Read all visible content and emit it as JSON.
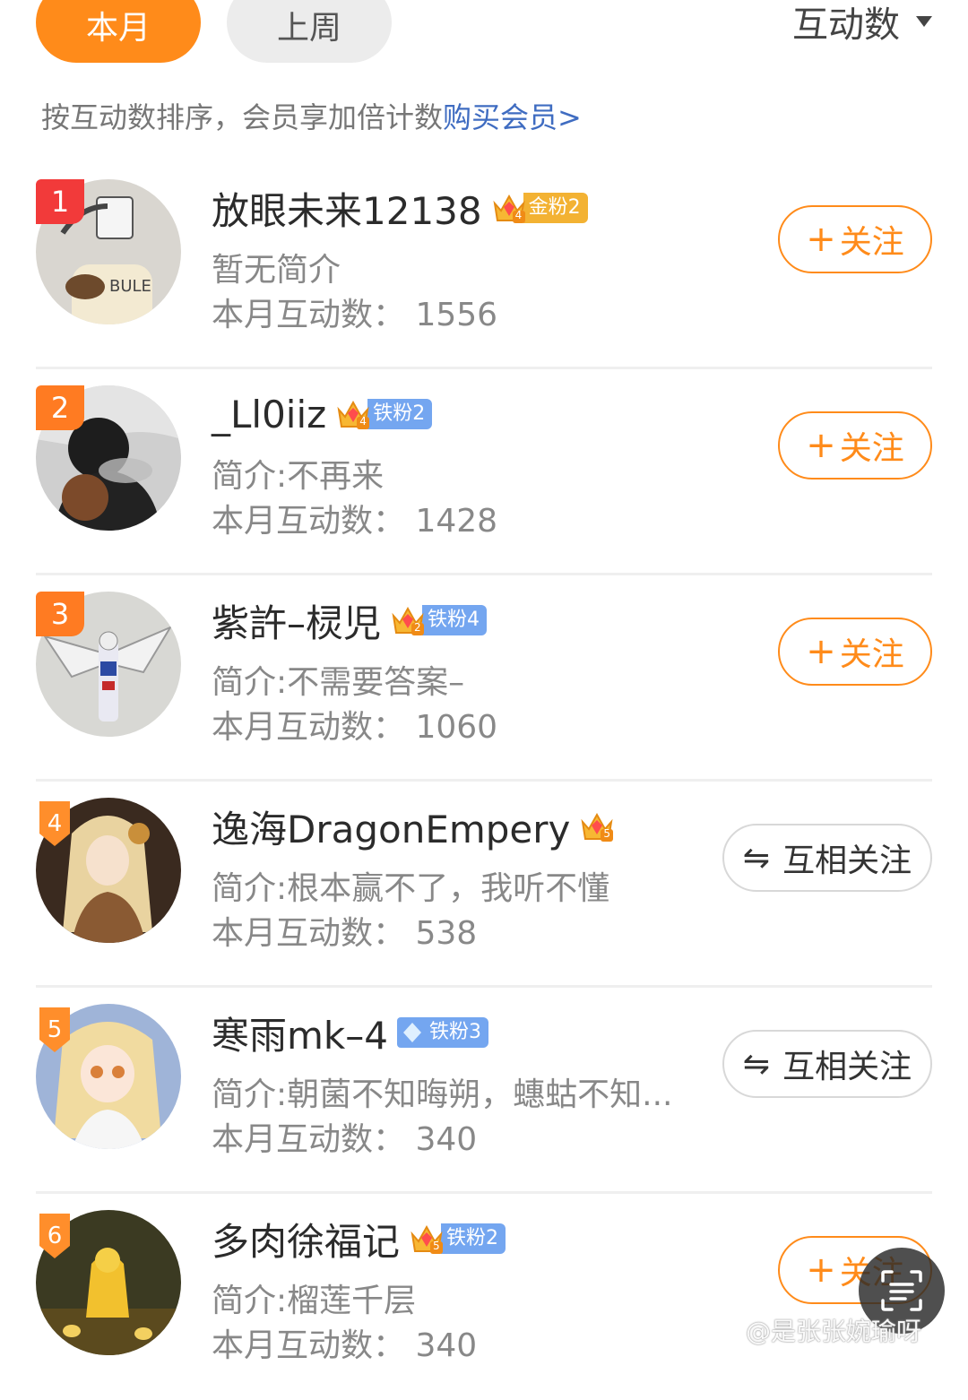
{
  "tabs": [
    {
      "label": "本月"
    },
    {
      "label": "上周"
    }
  ],
  "sort": {
    "label": "互动数"
  },
  "hint": {
    "text": "按互动数排序，会员享加倍计数",
    "link": "购买会员>"
  },
  "colors": {
    "accent": "#ff8b1a",
    "link": "#3f6cc1",
    "gold_tag": "#f3b233",
    "iron_tag": "#74a6f0",
    "rank1": "#f23a3a"
  },
  "rows": [
    {
      "rank": "1",
      "name": "放眼未来12138",
      "crown_level": "4",
      "tag": "金粉2",
      "intro": "暂无简介",
      "count": "本月互动数：  1556",
      "button": "关注",
      "plus": "+",
      "button_type": "follow"
    },
    {
      "rank": "2",
      "name": "_Ll0iiz",
      "crown_level": "4",
      "tag": "铁粉2",
      "intro": "简介:不再来",
      "count": "本月互动数：  1428",
      "button": "关注",
      "plus": "+",
      "button_type": "follow"
    },
    {
      "rank": "3",
      "name": "紫許–棂児",
      "crown_level": "2",
      "tag": "铁粉4",
      "intro": "简介:不需要答案–",
      "count": "本月互动数：  1060",
      "button": "关注",
      "plus": "+",
      "button_type": "follow"
    },
    {
      "rank": "4",
      "name": "逸海DragonEmpery",
      "crown_level": "5",
      "tag": "",
      "intro": "简介:根本赢不了，我听不懂",
      "count": "本月互动数：  538",
      "button": "互相关注",
      "arrow": "⇋",
      "button_type": "mutual"
    },
    {
      "rank": "5",
      "name": "寒雨mk–4",
      "crown_level": "",
      "tag": "铁粉3",
      "intro": "简介:朝菌不知晦朔，蟪蛄不知...",
      "count": "本月互动数：  340",
      "button": "互相关注",
      "arrow": "⇋",
      "button_type": "mutual"
    },
    {
      "rank": "6",
      "name": "多肉徐福记",
      "crown_level": "5",
      "tag": "铁粉2",
      "intro": "简介:榴莲千层",
      "count": "本月互动数：  340",
      "button": "关注",
      "plus": "+",
      "button_type": "follow"
    }
  ],
  "watermark": "@是张张婉瑜呀"
}
